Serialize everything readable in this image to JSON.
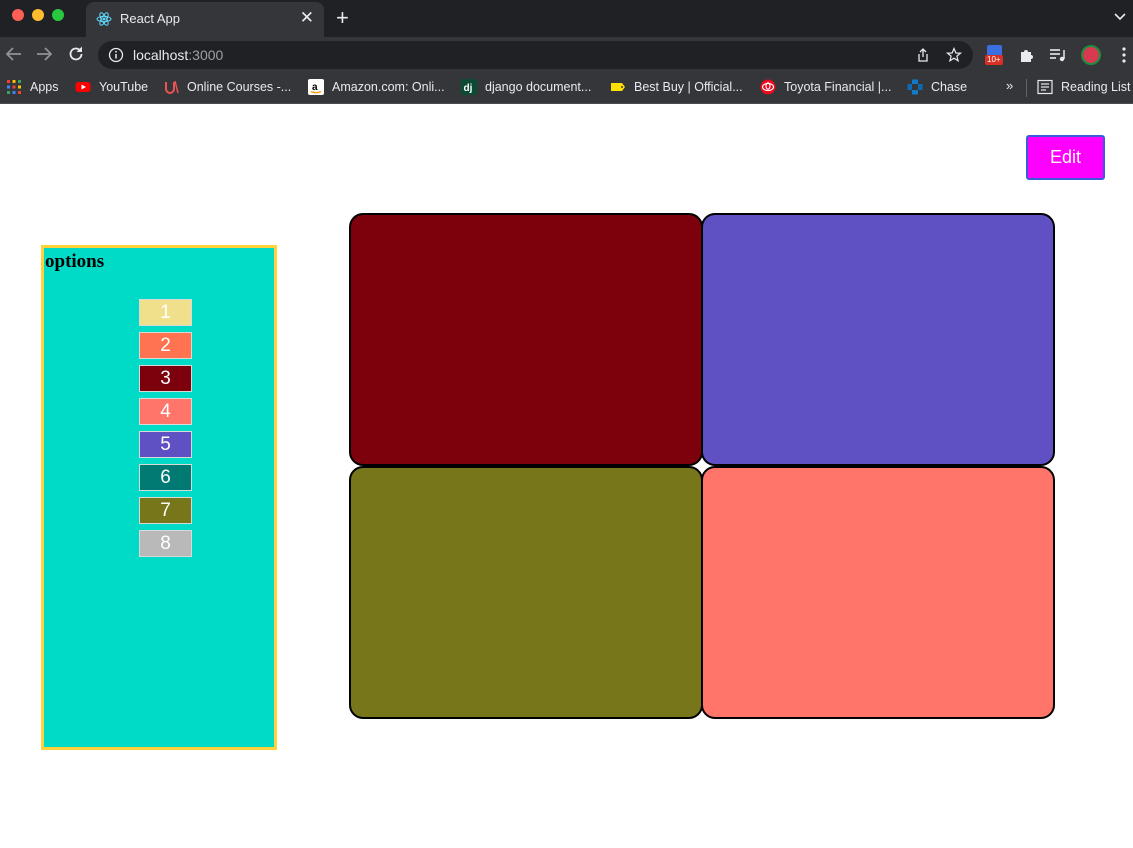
{
  "browser": {
    "tab_title": "React App",
    "url_host": "localhost",
    "url_port": ":3000",
    "extension_badge": "10+",
    "bookmarks": [
      {
        "label": "Apps",
        "icon": "apps-grid-icon",
        "color": "#ea4335"
      },
      {
        "label": "YouTube",
        "icon": "youtube-icon",
        "color": "#ff0000"
      },
      {
        "label": "Online Courses -...",
        "icon": "udemy-icon",
        "color": "#ec5252"
      },
      {
        "label": "Amazon.com: Onli...",
        "icon": "amazon-icon",
        "color": "#ffffff"
      },
      {
        "label": "django document...",
        "icon": "django-icon",
        "color": "#0c4b33"
      },
      {
        "label": "Best Buy | Official...",
        "icon": "bestbuy-tag-icon",
        "color": "#ffe000"
      },
      {
        "label": "Toyota Financial |...",
        "icon": "toyota-icon",
        "color": "#eb0a1e"
      },
      {
        "label": "Chase",
        "icon": "chase-icon",
        "color": "#117aca"
      }
    ],
    "more_bookmarks": "»",
    "reading_list": "Reading List"
  },
  "page": {
    "edit_label": "Edit",
    "edit_color": "#ff00ff",
    "options_title": "options",
    "options_bg": "#00dbc8",
    "options_border": "#ffd23c",
    "options": [
      {
        "label": "1",
        "color": "#f0e08c"
      },
      {
        "label": "2",
        "color": "#ff7350"
      },
      {
        "label": "3",
        "color": "#7d000d"
      },
      {
        "label": "4",
        "color": "#ff7569"
      },
      {
        "label": "5",
        "color": "#5f51c4"
      },
      {
        "label": "6",
        "color": "#007a73"
      },
      {
        "label": "7",
        "color": "#77761a"
      },
      {
        "label": "8",
        "color": "#b9b9b9"
      }
    ],
    "grid_cells": [
      {
        "color": "#7d000d"
      },
      {
        "color": "#5f51c4"
      },
      {
        "color": "#77761a"
      },
      {
        "color": "#ff7569"
      }
    ]
  }
}
